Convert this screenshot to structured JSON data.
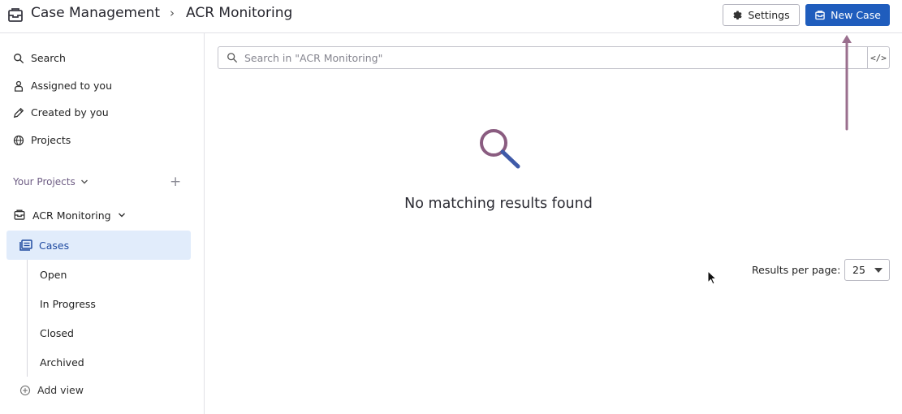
{
  "header": {
    "breadcrumb_root": "Case Management",
    "breadcrumb_separator": "›",
    "breadcrumb_current": "ACR Monitoring",
    "settings_label": "Settings",
    "new_case_label": "New Case",
    "accent_color": "#1f5dbd"
  },
  "sidebar": {
    "nav": [
      {
        "label": "Search",
        "icon": "search-icon"
      },
      {
        "label": "Assigned to you",
        "icon": "user-icon"
      },
      {
        "label": "Created by you",
        "icon": "pencil-icon"
      },
      {
        "label": "Projects",
        "icon": "globe-icon"
      }
    ],
    "section_title": "Your Projects",
    "project": {
      "label": "ACR Monitoring",
      "icon": "case-box-icon"
    },
    "cases_label": "Cases",
    "views": [
      "Open",
      "In Progress",
      "Closed",
      "Archived"
    ],
    "add_view_label": "Add view"
  },
  "main": {
    "search_placeholder": "Search in \"ACR Monitoring\"",
    "code_toggle_label": "</>",
    "empty_message": "No matching results found",
    "results_per_page_label": "Results per page:",
    "results_per_page_value": "25"
  }
}
